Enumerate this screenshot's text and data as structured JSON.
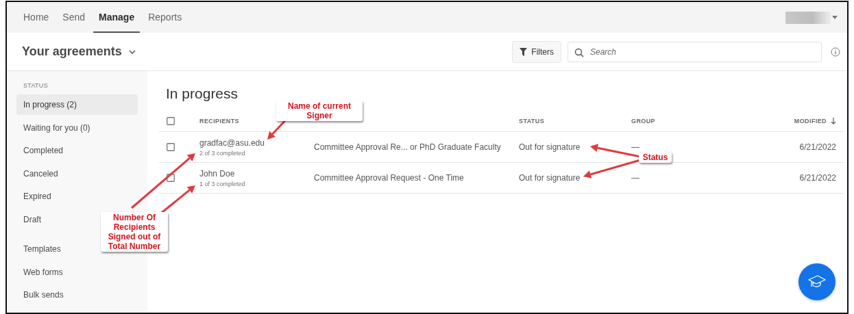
{
  "nav": {
    "tabs": [
      {
        "label": "Home",
        "selected": false
      },
      {
        "label": "Send",
        "selected": false
      },
      {
        "label": "Manage",
        "selected": true
      },
      {
        "label": "Reports",
        "selected": false
      }
    ]
  },
  "header": {
    "title": "Your agreements",
    "filters_button": "Filters",
    "search": {
      "placeholder": "Search"
    }
  },
  "sidebar": {
    "heading": "STATUS",
    "items": [
      {
        "label": "In progress (2)",
        "selected": true
      },
      {
        "label": "Waiting for you (0)",
        "selected": false
      },
      {
        "label": "Completed",
        "selected": false
      },
      {
        "label": "Canceled",
        "selected": false
      },
      {
        "label": "Expired",
        "selected": false
      },
      {
        "label": "Draft",
        "selected": false
      }
    ],
    "links": [
      "Templates",
      "Web forms",
      "Bulk sends"
    ]
  },
  "main": {
    "title": "In progress",
    "table": {
      "select_all": {
        "checked": false
      },
      "columns": {
        "recipients": "RECIPIENTS",
        "status": "STATUS",
        "group": "GROUP",
        "modified": "MODIFIED"
      },
      "rows": [
        {
          "checked": false,
          "recipient": "gradfac@asu.edu",
          "progress": "2 of 3 completed",
          "name": "Committee Approval Re... or PhD Graduate Faculty",
          "status": "Out for signature",
          "group": "—",
          "modified": "6/21/2022"
        },
        {
          "checked": false,
          "recipient": "John Doe",
          "progress": "1 of 3 completed",
          "name": "Committee Approval Request - One Time",
          "status": "Out for signature",
          "group": "—",
          "modified": "6/21/2022"
        }
      ]
    }
  },
  "annotations": [
    {
      "text": "Name of current Signer"
    },
    {
      "text": "Status"
    },
    {
      "text": "Number Of Recipients Signed out of Total Number"
    }
  ]
}
